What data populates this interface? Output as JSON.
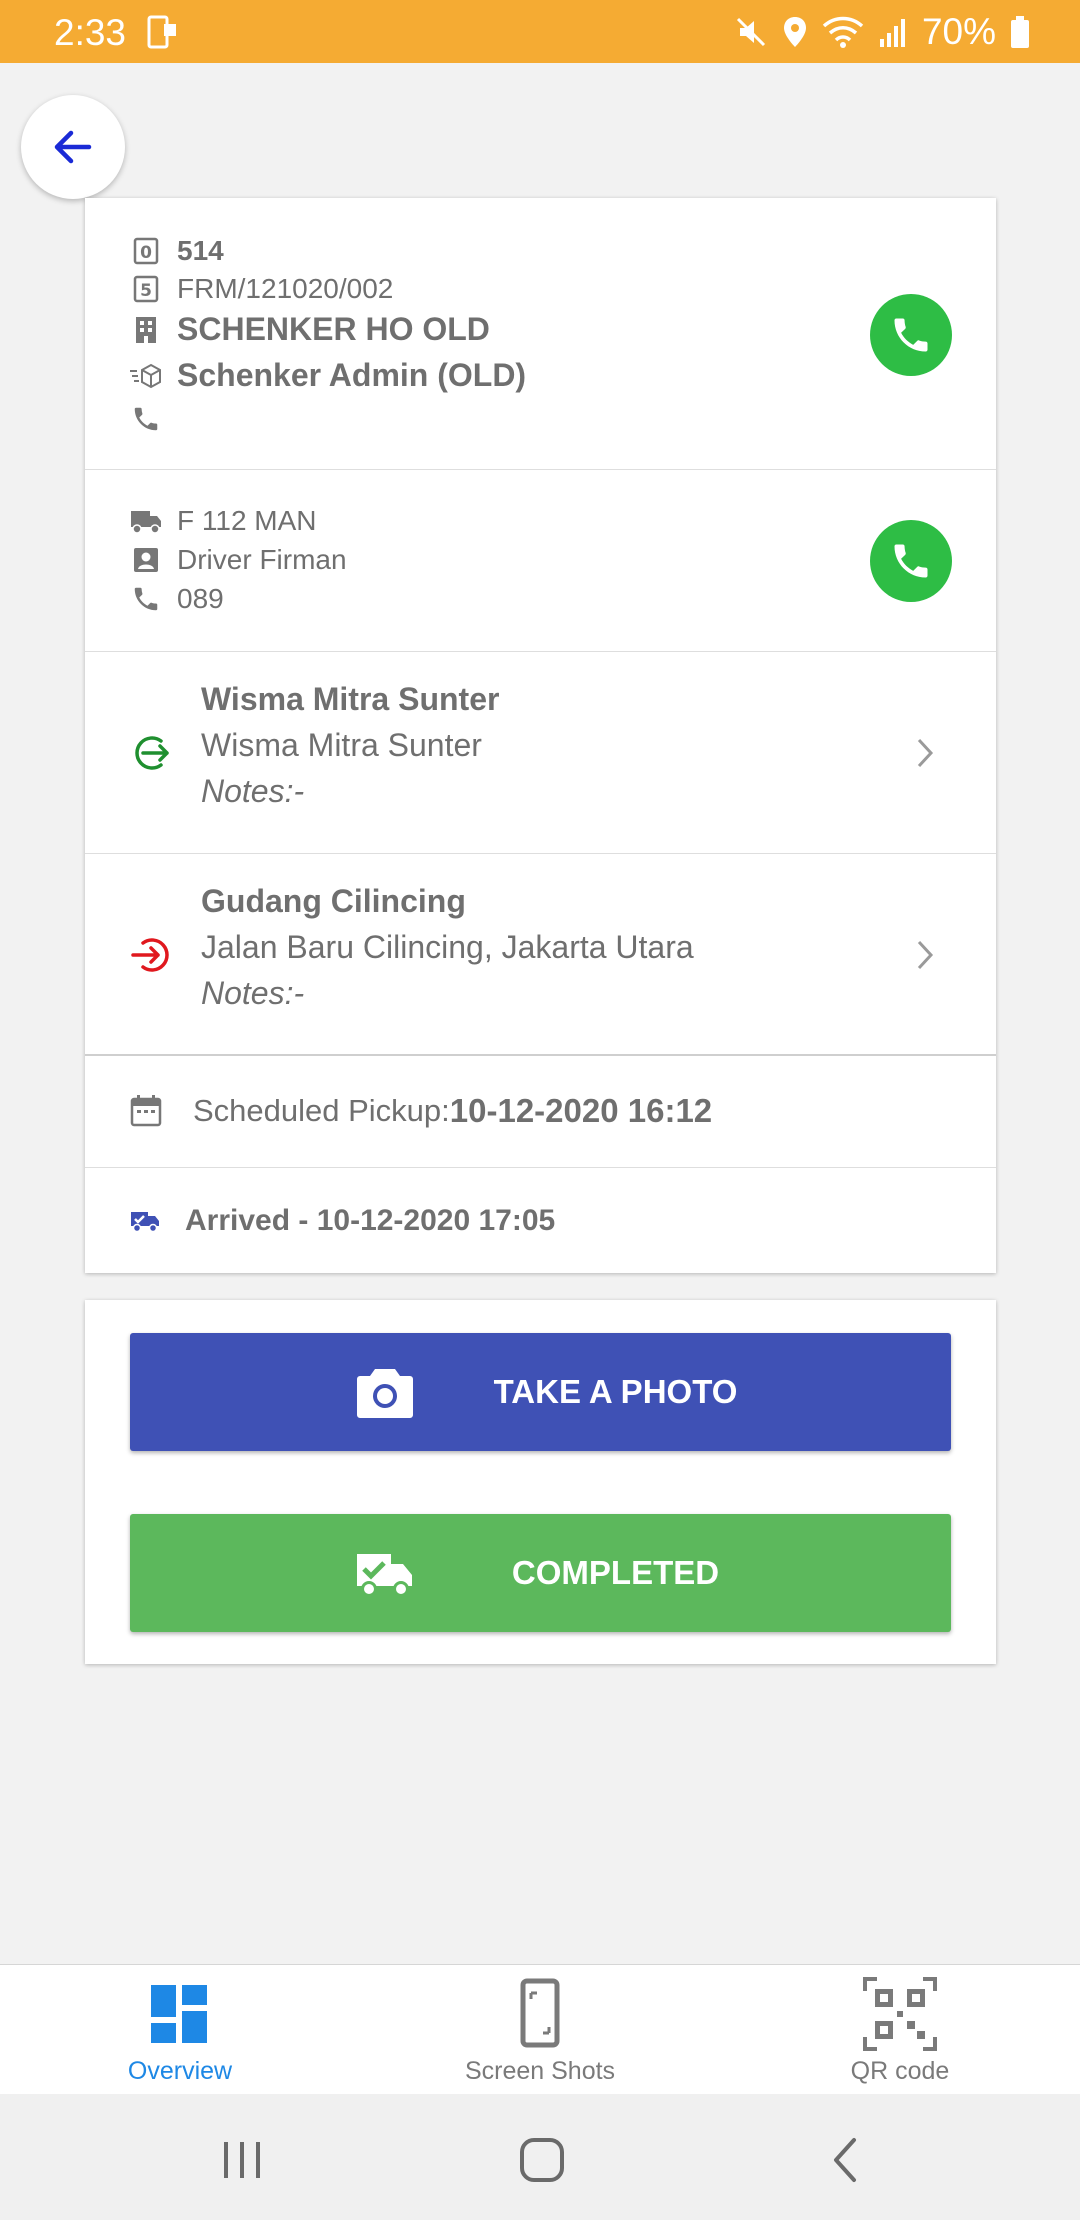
{
  "status_bar": {
    "time": "2:33",
    "battery": "70%",
    "icons": [
      "mute-icon",
      "location-icon",
      "wifi-icon",
      "signal-icon",
      "battery-icon"
    ],
    "background": "#f5ab33"
  },
  "order": {
    "number": "514",
    "code": "FRM/121020/002",
    "company": "SCHENKER HO OLD",
    "contact": "Schenker Admin (OLD)",
    "contact_phone": ""
  },
  "vehicle": {
    "plate": "F 112 MAN",
    "driver": "Driver Firman",
    "phone": "089"
  },
  "pickup": {
    "title": "Wisma Mitra Sunter",
    "address": "Wisma Mitra Sunter",
    "notes": "Notes:-"
  },
  "dropoff": {
    "title": "Gudang Cilincing",
    "address": "Jalan Baru Cilincing, Jakarta Utara",
    "notes": "Notes:-"
  },
  "schedule": {
    "label": "Scheduled Pickup:",
    "value": "10-12-2020 16:12"
  },
  "status": {
    "text": "Arrived - 10-12-2020 17:05"
  },
  "actions": {
    "take_photo": "TAKE A PHOTO",
    "completed": "COMPLETED"
  },
  "bottom_nav": {
    "items": [
      {
        "label": "Overview",
        "icon": "dashboard-icon",
        "active": true
      },
      {
        "label": "Screen Shots",
        "icon": "phone-screenshot-icon",
        "active": false
      },
      {
        "label": "QR code",
        "icon": "qr-code-icon",
        "active": false
      }
    ]
  },
  "colors": {
    "accent_blue": "#3f51b5",
    "success_green": "#5cb85c",
    "call_green": "#2ebd45",
    "nav_active": "#1e88e5"
  }
}
